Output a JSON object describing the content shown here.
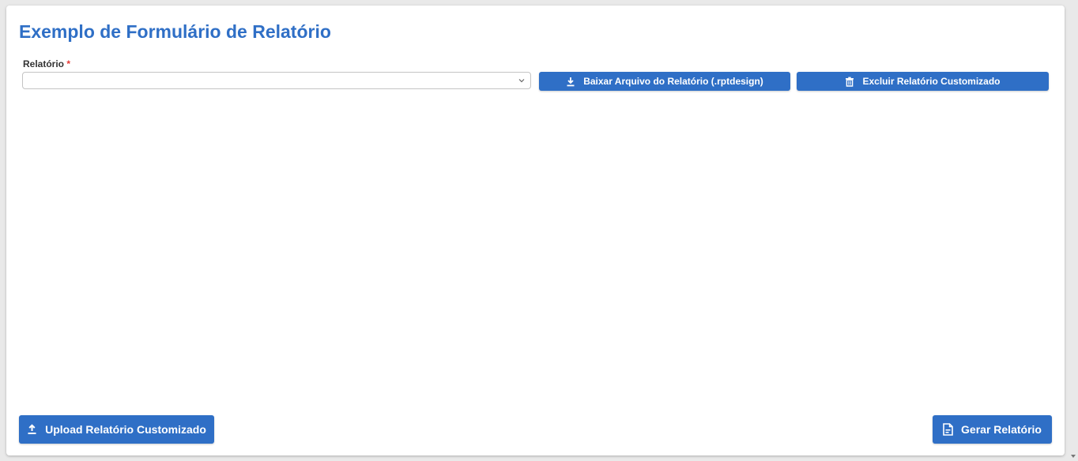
{
  "page": {
    "title": "Exemplo de Formulário de Relatório"
  },
  "form": {
    "relatorio_label": "Relatório",
    "required_marker": "*",
    "relatorio_value": ""
  },
  "buttons": {
    "download_label": "Baixar Arquivo do Relatório (.rptdesign)",
    "delete_label": "Excluir Relatório Customizado",
    "upload_label": "Upload Relatório Customizado",
    "generate_label": "Gerar Relatório"
  },
  "icons": {
    "download": "download-icon",
    "delete": "trash-icon",
    "upload": "upload-icon",
    "generate": "file-document-icon",
    "dropdown": "chevron-down-icon"
  },
  "colors": {
    "primary": "#2f6fc6",
    "required": "#e53935"
  }
}
